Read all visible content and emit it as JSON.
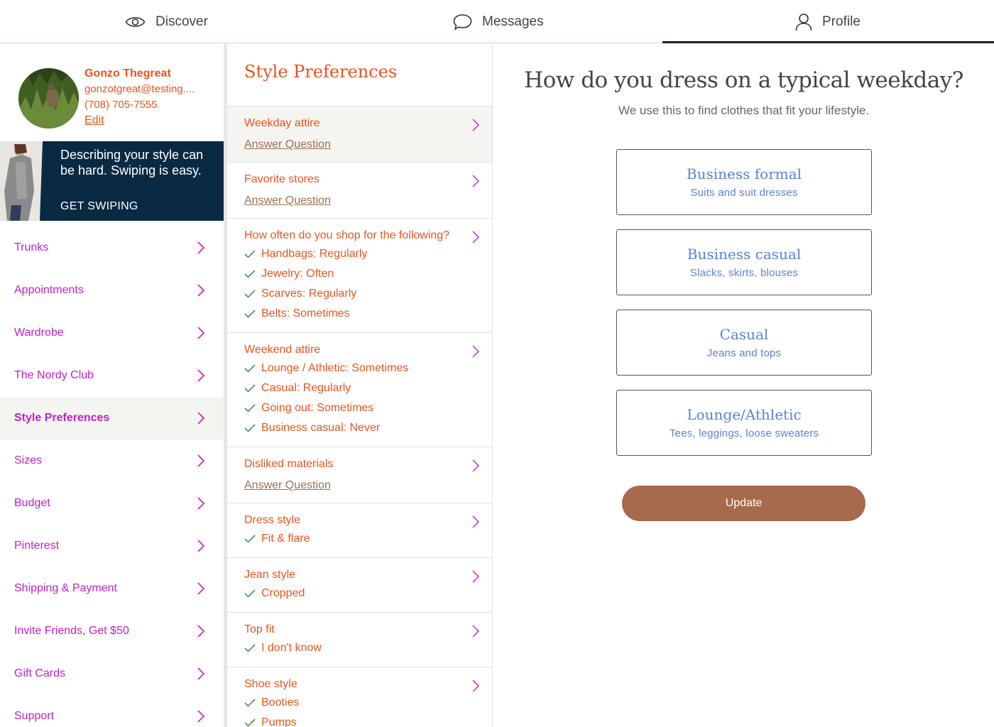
{
  "nav": {
    "tabs": [
      {
        "label": "Discover",
        "icon": "eye-icon"
      },
      {
        "label": "Messages",
        "icon": "chat-bubble-icon"
      },
      {
        "label": "Profile",
        "icon": "person-icon"
      }
    ],
    "active_tab": "Profile"
  },
  "profile": {
    "name": "Gonzo Thegreat",
    "email": "gonzotgreat@testing....",
    "phone": "(708) 705-7555",
    "edit_label": "Edit"
  },
  "promo": {
    "text": "Describing your style can be hard. Swiping is easy.",
    "cta": "GET SWIPING"
  },
  "menu": {
    "items": [
      {
        "label": "Trunks"
      },
      {
        "label": "Appointments"
      },
      {
        "label": "Wardrobe"
      },
      {
        "label": "The Nordy Club"
      },
      {
        "label": "Style Preferences",
        "active": true
      },
      {
        "label": "Sizes"
      },
      {
        "label": "Budget"
      },
      {
        "label": "Pinterest"
      },
      {
        "label": "Shipping & Payment"
      },
      {
        "label": "Invite Friends, Get $50"
      },
      {
        "label": "Gift Cards"
      },
      {
        "label": "Support"
      }
    ]
  },
  "style_prefs": {
    "title": "Style Preferences",
    "answer_link": "Answer Question",
    "questions": [
      {
        "title": "Weekday attire",
        "answers": []
      },
      {
        "title": "Favorite stores",
        "answers": []
      },
      {
        "title": "How often do you shop for the following?",
        "answers": [
          "Handbags: Regularly",
          "Jewelry: Often",
          "Scarves: Regularly",
          "Belts: Sometimes"
        ]
      },
      {
        "title": "Weekend attire",
        "answers": [
          "Lounge / Athletic: Sometimes",
          "Casual: Regularly",
          "Going out: Sometimes",
          "Business casual: Never"
        ]
      },
      {
        "title": "Disliked materials",
        "answers": []
      },
      {
        "title": "Dress style",
        "answers": [
          "Fit & flare"
        ]
      },
      {
        "title": "Jean style",
        "answers": [
          "Cropped"
        ]
      },
      {
        "title": "Top fit",
        "answers": [
          "I don't know"
        ]
      },
      {
        "title": "Shoe style",
        "answers": [
          "Booties",
          "Pumps"
        ]
      }
    ]
  },
  "question_pane": {
    "title": "How do you dress on a typical weekday?",
    "subtitle": "We use this to find clothes that fit your lifestyle.",
    "options": [
      {
        "title": "Business formal",
        "desc": "Suits and suit dresses"
      },
      {
        "title": "Business casual",
        "desc": "Slacks, skirts, blouses"
      },
      {
        "title": "Casual",
        "desc": "Jeans and tops"
      },
      {
        "title": "Lounge/Athletic",
        "desc": "Tees, leggings, loose sweaters"
      }
    ],
    "update_label": "Update"
  },
  "colors": {
    "accent_orange": "#e8541c",
    "menu_magenta": "#c020c8",
    "option_blue": "#5b7fd8",
    "button_brown": "#a86a4c",
    "promo_navy": "#0a2a43",
    "check_green": "#2e8b3a"
  }
}
